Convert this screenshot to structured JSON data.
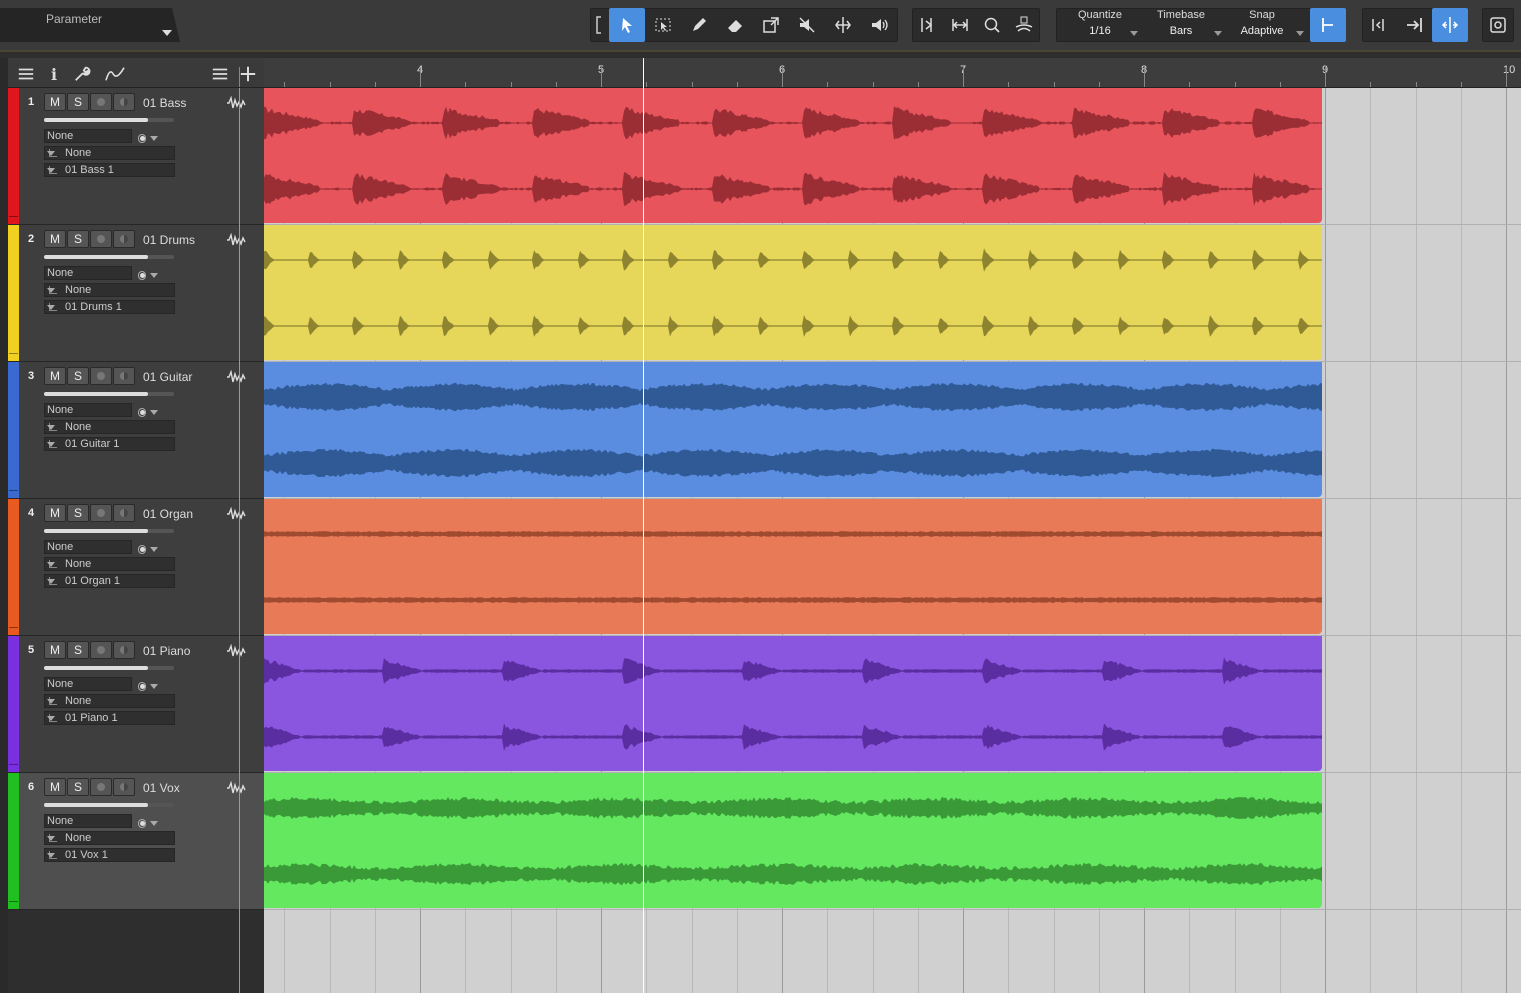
{
  "toolbar": {
    "parameter_label": "Parameter",
    "quantize": {
      "label": "Quantize",
      "value": "1/16"
    },
    "timebase": {
      "label": "Timebase",
      "value": "Bars"
    },
    "snap": {
      "label": "Snap",
      "value": "Adaptive"
    },
    "accent": "#4a8ee0"
  },
  "ruler": {
    "bars": [
      "4",
      "5",
      "6",
      "7",
      "8",
      "9",
      "10"
    ]
  },
  "tracks": [
    {
      "num": "1",
      "name": "01 Bass",
      "input": "None",
      "output": "None",
      "take": "01 Bass 1",
      "color": "#e8545c",
      "wave": "#9b2e35",
      "strip": "#e0161e",
      "volume": 0.8
    },
    {
      "num": "2",
      "name": "01 Drums",
      "input": "None",
      "output": "None",
      "take": "01 Drums 1",
      "color": "#e6d65a",
      "wave": "#8e8430",
      "strip": "#f0d020",
      "volume": 0.8
    },
    {
      "num": "3",
      "name": "01 Guitar",
      "input": "None",
      "output": "None",
      "take": "01 Guitar 1",
      "color": "#5a8de0",
      "wave": "#2f5a96",
      "strip": "#3a6ad0",
      "volume": 0.8
    },
    {
      "num": "4",
      "name": "01 Organ",
      "input": "None",
      "output": "None",
      "take": "01 Organ 1",
      "color": "#e87a58",
      "wave": "#a04a30",
      "strip": "#e85a20",
      "volume": 0.8
    },
    {
      "num": "5",
      "name": "01 Piano",
      "input": "None",
      "output": "None",
      "take": "01 Piano 1",
      "color": "#8a56e0",
      "wave": "#5a2ea0",
      "strip": "#7a30e0",
      "volume": 0.8
    },
    {
      "num": "6",
      "name": "01 Vox",
      "input": "None",
      "output": "None",
      "take": "01 Vox 1",
      "color": "#64e860",
      "wave": "#3a9a38",
      "strip": "#20c020",
      "volume": 0.8
    }
  ],
  "buttons": {
    "mute": "M",
    "solo": "S"
  },
  "icons": {
    "panel": [
      "list-icon",
      "info-icon",
      "wrench-icon",
      "automation-icon",
      "track-list-icon",
      "add-track-icon"
    ],
    "tools": [
      "select-bracket-icon",
      "arrow-tool-icon",
      "range-tool-icon",
      "pencil-tool-icon",
      "eraser-tool-icon",
      "bend-tool-icon",
      "mute-tool-icon",
      "split-tool-icon",
      "listen-tool-icon"
    ]
  }
}
